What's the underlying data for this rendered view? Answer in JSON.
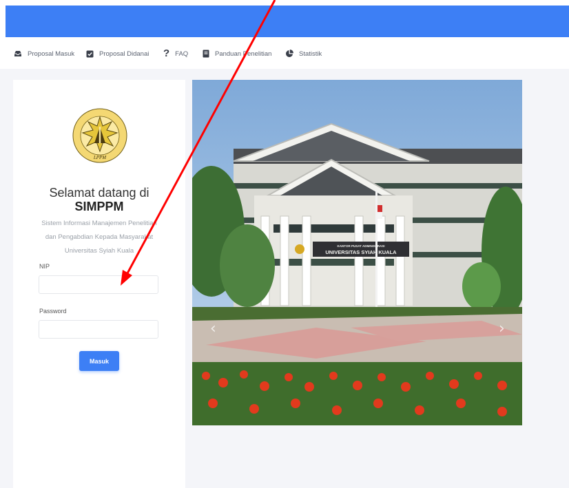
{
  "nav": {
    "items": [
      {
        "label": "Proposal Masuk",
        "icon": "inbox-icon"
      },
      {
        "label": "Proposal Didanai",
        "icon": "checkbox-icon"
      },
      {
        "label": "FAQ",
        "icon": "question-icon"
      },
      {
        "label": "Panduan Penelitian",
        "icon": "book-icon"
      },
      {
        "label": "Statistik",
        "icon": "pie-chart-icon"
      }
    ]
  },
  "login": {
    "logo_text": "LPPM",
    "welcome": "Selamat datang di",
    "brand": "SIMPPM",
    "desc_line1": "Sistem Informasi Manajemen Penelitian",
    "desc_line2": "dan Pengabdian Kepada Masyarakat",
    "desc_line3": "Universitas Syiah Kuala",
    "nip_label": "NIP",
    "nip_value": "",
    "password_label": "Password",
    "password_value": "",
    "submit_label": "Masuk"
  },
  "photo": {
    "sign_line1": "KANTOR PUSAT ADMINISTRASI",
    "sign_line2": "UNIVERSITAS SYIAH KUALA",
    "prev_glyph": "‹",
    "next_glyph": "›"
  },
  "colors": {
    "primary": "#3d7ff5",
    "arrow": "#ff0000"
  }
}
